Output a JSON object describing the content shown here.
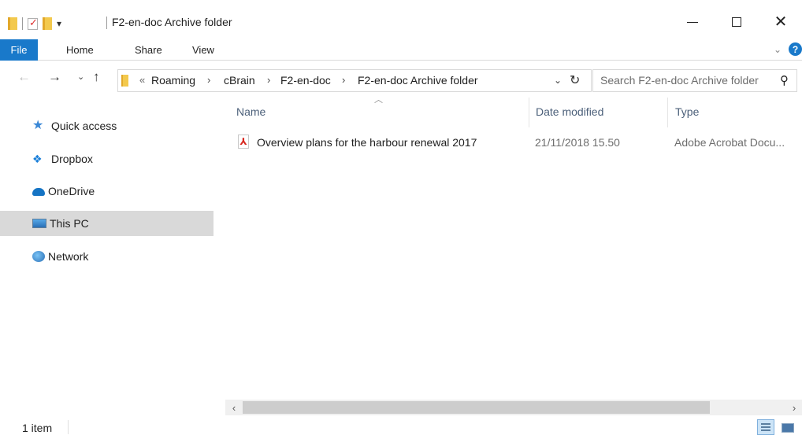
{
  "window": {
    "title": "F2-en-doc Archive folder",
    "quick_access_dropdown": "▾"
  },
  "ribbon": {
    "tabs": [
      {
        "label": "File"
      },
      {
        "label": "Home"
      },
      {
        "label": "Share"
      },
      {
        "label": "View"
      }
    ],
    "help_label": "?"
  },
  "address": {
    "overflow": "«",
    "crumbs": [
      "Roaming",
      "cBrain",
      "F2-en-doc",
      "F2-en-doc Archive folder"
    ],
    "separator": "›"
  },
  "search": {
    "placeholder": "Search F2-en-doc Archive folder"
  },
  "nav_pane": {
    "items": [
      {
        "label": "Quick access",
        "icon": "star-icon"
      },
      {
        "label": "Dropbox",
        "icon": "dropbox-icon"
      },
      {
        "label": "OneDrive",
        "icon": "onedrive-cloud-icon"
      },
      {
        "label": "This PC",
        "icon": "computer-icon",
        "selected": true
      },
      {
        "label": "Network",
        "icon": "network-icon"
      }
    ]
  },
  "file_list": {
    "columns": [
      "Name",
      "Date modified",
      "Type"
    ],
    "rows": [
      {
        "name": "Overview plans for the harbour renewal 2017",
        "date_modified": "21/11/2018 15.50",
        "type": "Adobe Acrobat Docu...",
        "icon": "pdf-icon"
      }
    ]
  },
  "status": {
    "item_count": "1 item"
  },
  "colors": {
    "accent": "#1979ca",
    "selected_nav": "#d9d9d9",
    "pdf_red": "#d7261e"
  }
}
